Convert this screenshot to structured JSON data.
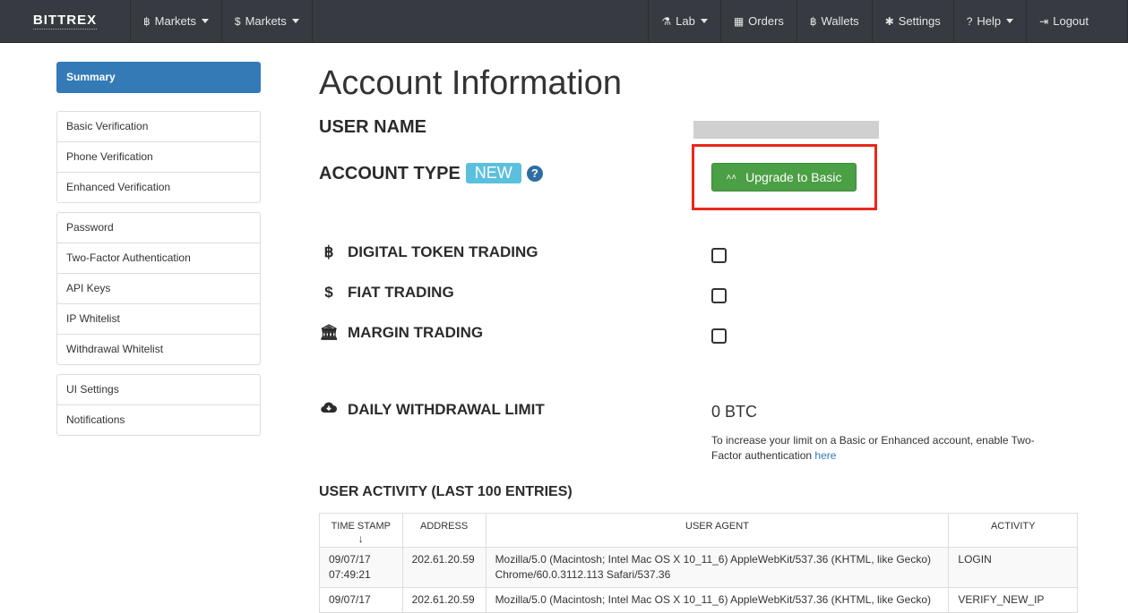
{
  "navbar": {
    "brand": "BITTREX",
    "left_items": [
      {
        "icon": "฿",
        "label": "Markets"
      },
      {
        "icon": "$",
        "label": "Markets"
      }
    ],
    "right_items": [
      {
        "icon": "⚗",
        "label": "Lab"
      },
      {
        "icon": "▦",
        "label": "Orders"
      },
      {
        "icon": "฿",
        "label": "Wallets"
      },
      {
        "icon": "✱",
        "label": "Settings"
      },
      {
        "icon": "?",
        "label": "Help"
      },
      {
        "icon": "⇥",
        "label": "Logout"
      }
    ]
  },
  "sidebar": {
    "active": "Summary",
    "groups": [
      [
        "Basic Verification",
        "Phone Verification",
        "Enhanced Verification"
      ],
      [
        "Password",
        "Two-Factor Authentication",
        "API Keys",
        "IP Whitelist",
        "Withdrawal Whitelist"
      ],
      [
        "UI Settings",
        "Notifications"
      ]
    ]
  },
  "main": {
    "title": "Account Information",
    "user_name_label": "USER NAME",
    "account_type_label": "ACCOUNT TYPE",
    "account_type_badge": "NEW",
    "help_glyph": "?",
    "upgrade_button": "Upgrade to Basic",
    "features": [
      {
        "icon": "฿",
        "label": "DIGITAL TOKEN TRADING"
      },
      {
        "icon": "$",
        "label": "FIAT TRADING"
      },
      {
        "icon": "🏛",
        "label": "MARGIN TRADING"
      }
    ],
    "withdrawal": {
      "label": "DAILY WITHDRAWAL LIMIT",
      "value": "0 BTC",
      "note": "To increase your limit on a Basic or Enhanced account, enable Two-Factor authentication ",
      "note_link": "here"
    },
    "activity": {
      "title": "USER ACTIVITY (LAST 100 ENTRIES)",
      "columns": [
        "TIME STAMP",
        "ADDRESS",
        "USER AGENT",
        "ACTIVITY"
      ],
      "sort_glyph": "↓",
      "rows": [
        {
          "date": "09/07/17",
          "time": "07:49:21",
          "address": "202.61.20.59",
          "agent_line1": "Mozilla/5.0 (Macintosh; Intel Mac OS X 10_11_6) AppleWebKit/537.36 (KHTML, like Gecko)",
          "agent_line2": "Chrome/60.0.3112.113 Safari/537.36",
          "activity": "LOGIN"
        },
        {
          "date": "09/07/17",
          "time": "",
          "address": "202.61.20.59",
          "agent_line1": "Mozilla/5.0 (Macintosh; Intel Mac OS X 10_11_6) AppleWebKit/537.36 (KHTML, like Gecko)",
          "agent_line2": "",
          "activity": "VERIFY_NEW_IP"
        }
      ]
    }
  },
  "colors": {
    "navbar": "#373b41",
    "active_sidebar": "#337ab7",
    "badge": "#5bc0de",
    "upgrade_button": "#4b9f44",
    "highlight_box": "#e8291c"
  }
}
